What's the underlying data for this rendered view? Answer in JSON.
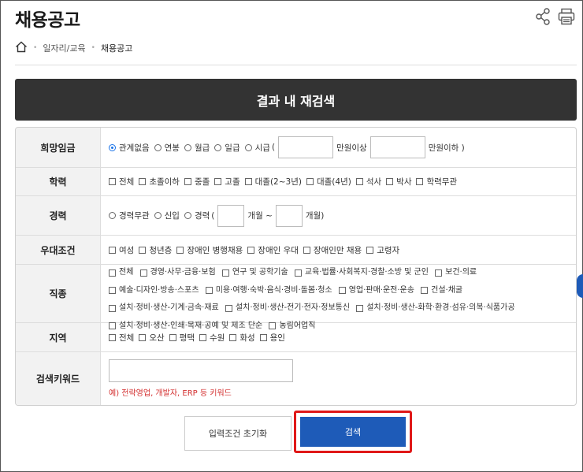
{
  "page": {
    "title": "채용공고"
  },
  "breadcrumb": {
    "level1": "일자리/교육",
    "level2": "채용공고"
  },
  "banner": {
    "label": "결과 내 재검색"
  },
  "form": {
    "wage": {
      "label": "희망임금",
      "options": [
        "관계없음",
        "연봉",
        "월급",
        "일급",
        "시급"
      ],
      "paren_open": "(",
      "min_suffix": "만원이상",
      "max_suffix": "만원이하 )"
    },
    "education": {
      "label": "학력",
      "options": [
        "전체",
        "초졸이하",
        "중졸",
        "고졸",
        "대졸(2~3년)",
        "대졸(4년)",
        "석사",
        "박사",
        "학력무관"
      ]
    },
    "career": {
      "label": "경력",
      "options": [
        "경력무관",
        "신입",
        "경력"
      ],
      "paren_open": "(",
      "from_suffix": "개월 ~",
      "to_suffix": "개월)"
    },
    "preference": {
      "label": "우대조건",
      "options": [
        "여성",
        "청년층",
        "장애인 병행채용",
        "장애인 우대",
        "장애인만 채용",
        "고령자"
      ]
    },
    "job_type": {
      "label": "직종",
      "options": [
        "전체",
        "경영·사무·금융·보험",
        "연구 및 공학기술",
        "교육·법률·사회복지·경찰·소방 및 군인",
        "보건·의료",
        "예술·디자인·방송·스포츠",
        "미용·여행·숙박·음식·경비·돌봄·청소",
        "영업·판매·운전·운송",
        "건설·채굴",
        "설치·정비·생산-기계·금속·재료",
        "설치·정비·생산-전기·전자·정보통신",
        "설치·정비·생산-화학·환경·섬유·의복·식품가공",
        "설치·정비·생산-인쇄·목재·공예 및 제조 단순",
        "농림어업직"
      ]
    },
    "region": {
      "label": "지역",
      "options": [
        "전체",
        "오산",
        "평택",
        "수원",
        "화성",
        "용인"
      ]
    },
    "keyword": {
      "label": "검색키워드",
      "hint": "예) 전략영업, 개발자, ERP 등 키워드"
    }
  },
  "buttons": {
    "reset": "입력조건 초기화",
    "search": "검색"
  },
  "colors": {
    "banner": "#333333",
    "search_button": "#1e5bb8",
    "highlight": "#e01818",
    "hint": "#d32f2f"
  }
}
